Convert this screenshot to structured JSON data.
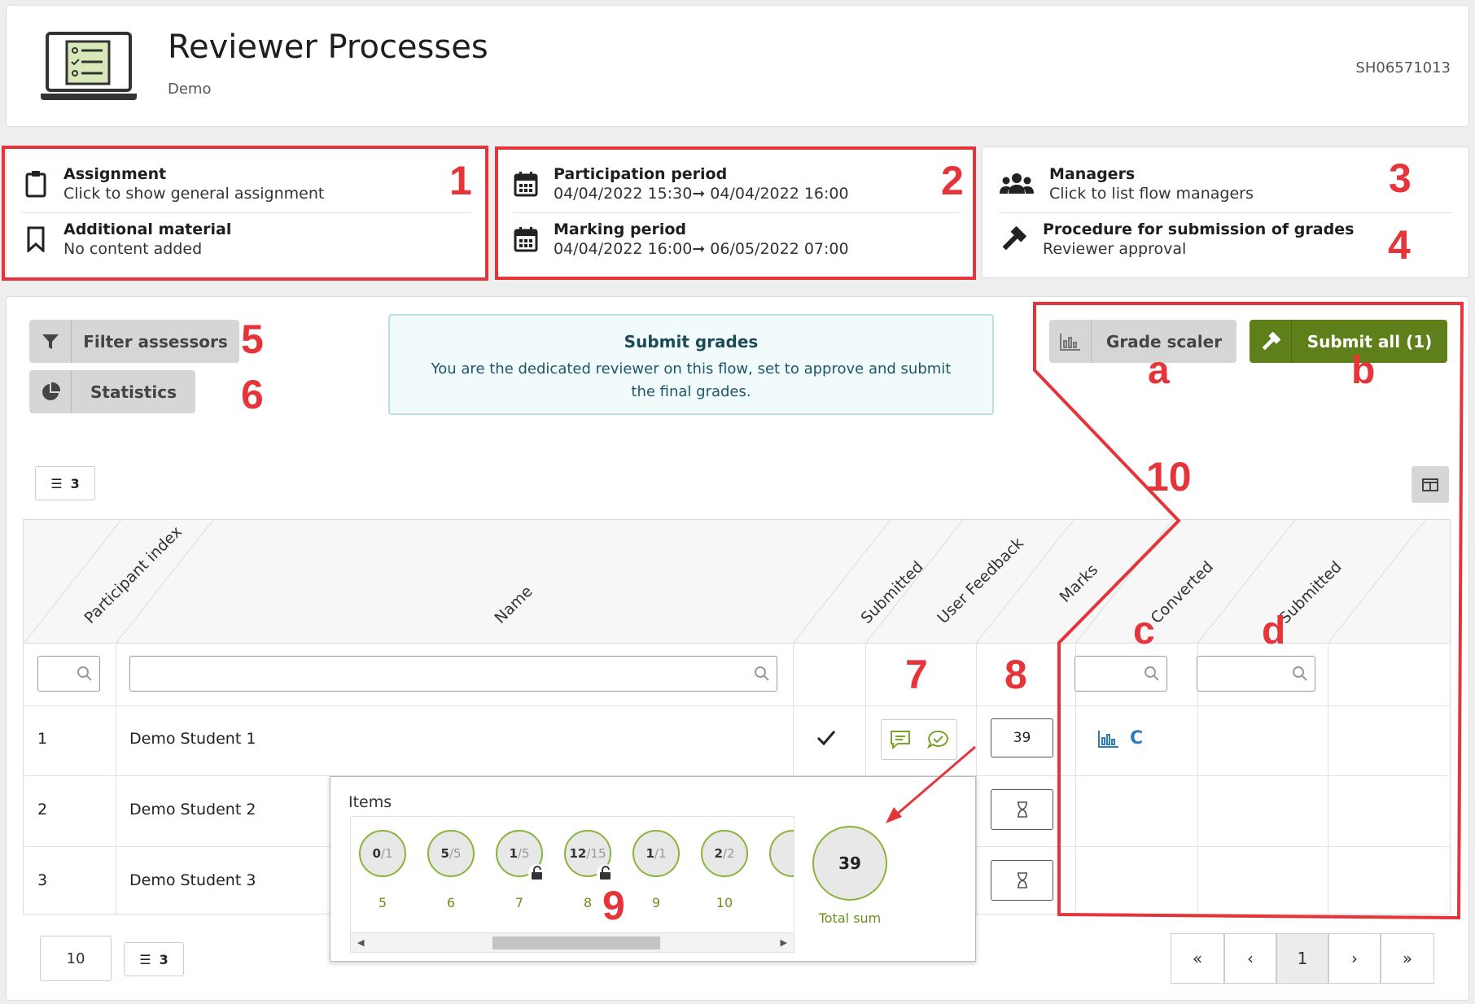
{
  "header": {
    "title": "Reviewer Processes",
    "subtitle": "Demo",
    "code": "SH06571013"
  },
  "info": {
    "assignment": {
      "label": "Assignment",
      "value": "Click to show general assignment"
    },
    "material": {
      "label": "Additional material",
      "value": "No content added"
    },
    "participation": {
      "label": "Participation period",
      "start": "04/04/2022 15:30",
      "end": "04/04/2022 16:00"
    },
    "marking": {
      "label": "Marking period",
      "start": "04/04/2022 16:00",
      "end": "06/05/2022 07:00"
    },
    "managers": {
      "label": "Managers",
      "value": "Click to list flow managers"
    },
    "procedure": {
      "label": "Procedure for submission of grades",
      "value": "Reviewer approval"
    }
  },
  "toolbar": {
    "filter_label": "Filter assessors",
    "stats_label": "Statistics",
    "grade_scaler_label": "Grade scaler",
    "submit_all_label": "Submit all (1)",
    "list_count": "3"
  },
  "notice": {
    "title": "Submit grades",
    "body": "You are the dedicated reviewer on this flow, set to approve and submit the final grades."
  },
  "table": {
    "headers": [
      "Participant index",
      "Name",
      "Submitted",
      "User Feedback",
      "Marks",
      "Converted",
      "Submitted"
    ],
    "rows": [
      {
        "index": "1",
        "name": "Demo Student 1",
        "marks": "39",
        "converted": "C"
      },
      {
        "index": "2",
        "name": "Demo Student 2"
      },
      {
        "index": "3",
        "name": "Demo Student 3"
      }
    ]
  },
  "popup": {
    "title": "Items",
    "items": [
      {
        "score": "0",
        "max": "/1",
        "num": "5"
      },
      {
        "score": "5",
        "max": "/5",
        "num": "6"
      },
      {
        "score": "1",
        "max": "/5",
        "num": "7"
      },
      {
        "score": "12",
        "max": "/15",
        "num": "8"
      },
      {
        "score": "1",
        "max": "/1",
        "num": "9"
      },
      {
        "score": "2",
        "max": "/2",
        "num": "10"
      }
    ],
    "total": "39",
    "total_label": "Total sum"
  },
  "footer": {
    "page_size": "10",
    "list_count": "3",
    "current_page": "1"
  },
  "annotations": {
    "n1": "1",
    "n2": "2",
    "n3": "3",
    "n4": "4",
    "n5": "5",
    "n6": "6",
    "n7": "7",
    "n8": "8",
    "n9": "9",
    "n10": "10",
    "a": "a",
    "b": "b",
    "c": "c",
    "d": "d"
  },
  "colors": {
    "accent_green": "#5f7f1a",
    "annotation_red": "#e5343a"
  }
}
